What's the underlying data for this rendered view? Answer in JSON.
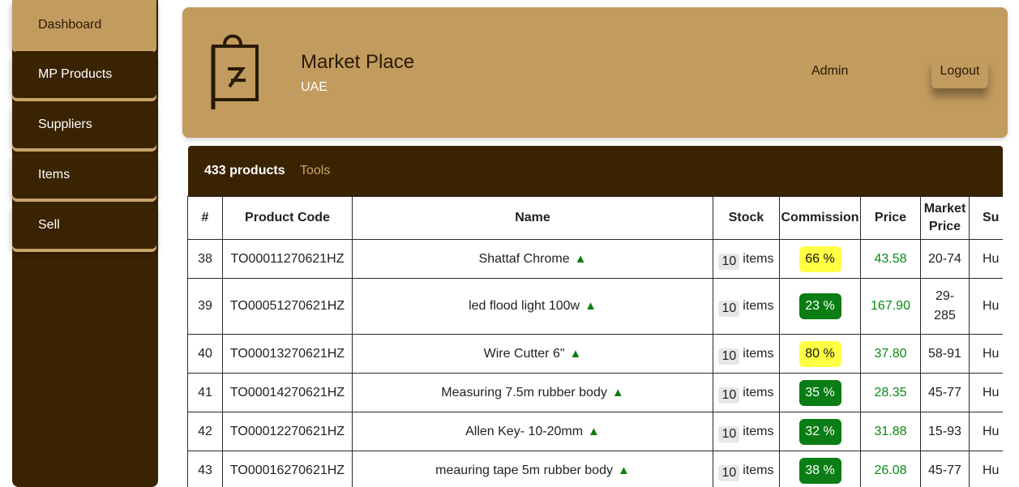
{
  "sidebar": {
    "items": [
      {
        "label": "Dashboard"
      },
      {
        "label": "MP Products"
      },
      {
        "label": "Suppliers"
      },
      {
        "label": "Items"
      },
      {
        "label": "Sell"
      }
    ]
  },
  "header": {
    "title": "Market Place",
    "subtitle": "UAE",
    "user": "Admin",
    "logout_label": "Logout"
  },
  "toolbar": {
    "count_label": "433 products",
    "category_label": "Tools"
  },
  "table": {
    "columns": [
      "#",
      "Product Code",
      "Name",
      "Stock",
      "Commission",
      "Price",
      "Market",
      "Price",
      "Su"
    ],
    "rows": [
      {
        "num": "38",
        "code": "TO00011270621HZ",
        "name": "Shattaf Chrome",
        "stock": "10",
        "unit": "items",
        "commission": "66 %",
        "commission_color": "#ffff44",
        "price": "43.58",
        "market": "20-74",
        "supplier": "Hu"
      },
      {
        "num": "39",
        "code": "TO00051270621HZ",
        "name": "led flood light 100w",
        "stock": "10",
        "unit": "items",
        "commission": "23 %",
        "commission_color": "#0a7d14",
        "price": "167.90",
        "market": "29-285",
        "supplier": "Hu"
      },
      {
        "num": "40",
        "code": "TO00013270621HZ",
        "name": "Wire Cutter 6\"",
        "stock": "10",
        "unit": "items",
        "commission": "80 %",
        "commission_color": "#ffff44",
        "price": "37.80",
        "market": "58-91",
        "supplier": "Hu"
      },
      {
        "num": "41",
        "code": "TO00014270621HZ",
        "name": "Measuring 7.5m rubber body",
        "stock": "10",
        "unit": "items",
        "commission": "35 %",
        "commission_color": "#0a7d14",
        "price": "28.35",
        "market": "45-77",
        "supplier": "Hu"
      },
      {
        "num": "42",
        "code": "TO00012270621HZ",
        "name": "Allen Key- 10-20mm",
        "stock": "10",
        "unit": "items",
        "commission": "32 %",
        "commission_color": "#0a7d14",
        "price": "31.88",
        "market": "15-93",
        "supplier": "Hu"
      },
      {
        "num": "43",
        "code": "TO00016270621HZ",
        "name": "meauring tape 5m rubber body",
        "stock": "10",
        "unit": "items",
        "commission": "38 %",
        "commission_color": "#0a7d14",
        "price": "26.08",
        "market": "45-77",
        "supplier": "Hu"
      }
    ]
  },
  "icons": {
    "logo": "shopping-bag-icon",
    "trend": "triangle-up-icon"
  },
  "colors": {
    "sidebar_bg": "#3a2300",
    "accent_tan": "#c29b5f",
    "badge_yellow": "#ffff44",
    "badge_green": "#0a7d14",
    "price_green": "#0a8a14"
  }
}
